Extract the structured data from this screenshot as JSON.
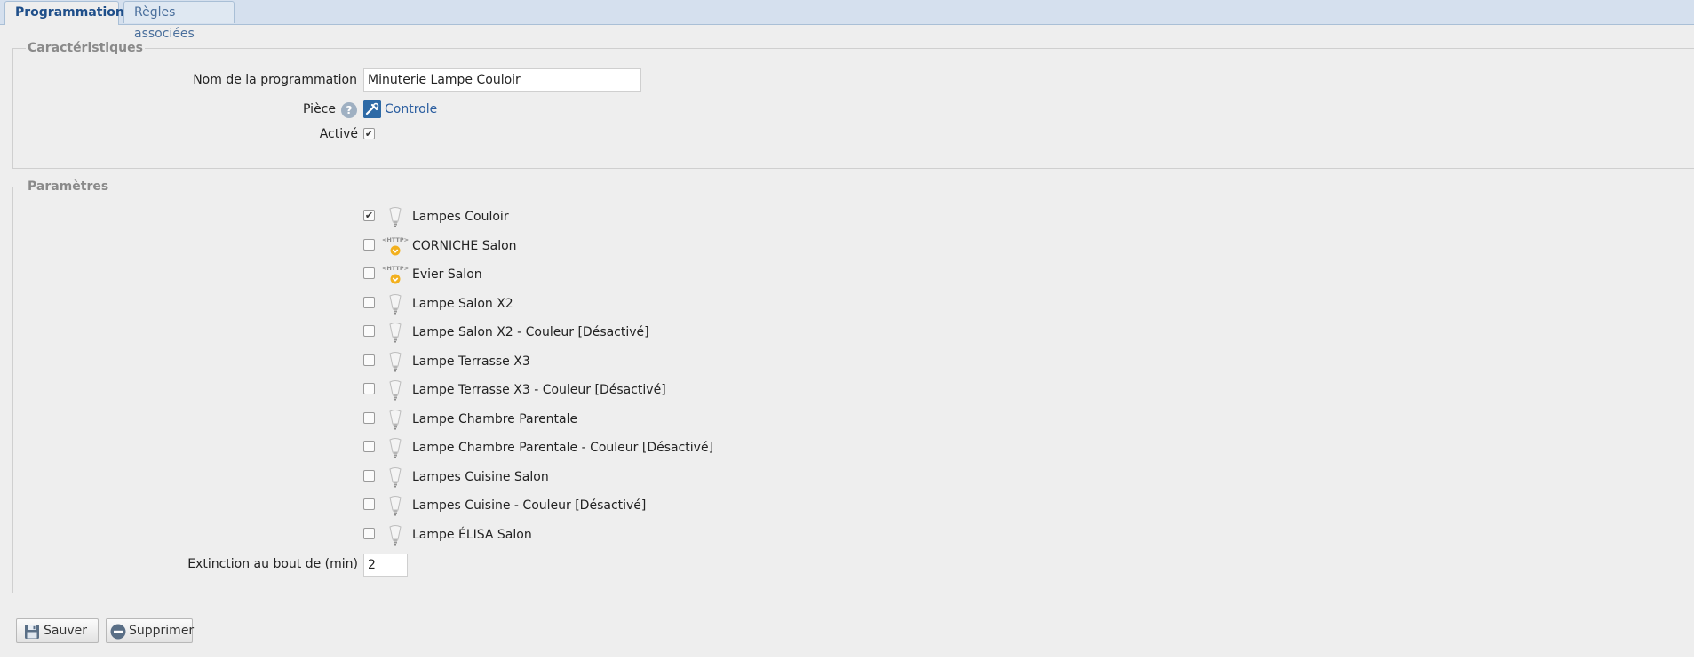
{
  "tabs": [
    {
      "label": "Programmation",
      "active": true
    },
    {
      "label": "Règles associées",
      "active": false
    }
  ],
  "characteristics": {
    "legend": "Caractéristiques",
    "name_label": "Nom de la programmation",
    "name_value": "Minuterie Lampe Couloir",
    "room_label": "Pièce",
    "room_value": "Controle",
    "active_label": "Activé",
    "active_checked": true
  },
  "parameters": {
    "legend": "Paramètres",
    "devices": [
      {
        "label": "Lampes Couloir",
        "checked": true,
        "icon": "bulb-icon"
      },
      {
        "label": "CORNICHE Salon",
        "checked": false,
        "icon": "http-icon"
      },
      {
        "label": "Evier Salon",
        "checked": false,
        "icon": "http-icon"
      },
      {
        "label": "Lampe Salon X2",
        "checked": false,
        "icon": "bulb-icon"
      },
      {
        "label": "Lampe Salon X2 - Couleur [Désactivé]",
        "checked": false,
        "icon": "bulb-icon"
      },
      {
        "label": "Lampe Terrasse X3",
        "checked": false,
        "icon": "bulb-icon"
      },
      {
        "label": "Lampe Terrasse X3 - Couleur [Désactivé]",
        "checked": false,
        "icon": "bulb-icon"
      },
      {
        "label": "Lampe Chambre Parentale",
        "checked": false,
        "icon": "bulb-icon"
      },
      {
        "label": "Lampe Chambre Parentale - Couleur [Désactivé]",
        "checked": false,
        "icon": "bulb-icon"
      },
      {
        "label": "Lampes Cuisine Salon",
        "checked": false,
        "icon": "bulb-icon"
      },
      {
        "label": "Lampes Cuisine - Couleur [Désactivé]",
        "checked": false,
        "icon": "bulb-icon"
      },
      {
        "label": "Lampe ÉLISA Salon",
        "checked": false,
        "icon": "bulb-icon"
      }
    ],
    "timeout_label": "Extinction au bout de (min)",
    "timeout_value": "2"
  },
  "actions": {
    "save_label": "Sauver",
    "delete_label": "Supprimer"
  }
}
